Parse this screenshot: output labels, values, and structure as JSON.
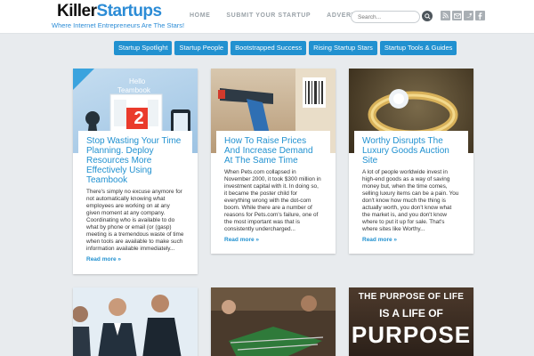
{
  "header": {
    "logo_killer": "Killer",
    "logo_startups": "Startups",
    "tagline": "Where Internet Entrepreneurs Are The Stars!",
    "nav": [
      "HOME",
      "SUBMIT YOUR STARTUP",
      "ADVERTISE"
    ],
    "search_placeholder": "Search...",
    "social": [
      "rss-icon",
      "email-icon",
      "twitter-icon",
      "facebook-icon"
    ]
  },
  "categories": [
    "Startup Spotlight",
    "Startup People",
    "Bootstrapped Success",
    "Rising Startup Stars",
    "Startup Tools & Guides"
  ],
  "posts": [
    {
      "title": "Stop Wasting Your Time Planning. Deploy Resources More Effectively Using Teambook",
      "excerpt": "There's simply no excuse anymore for not automatically knowing what employees are working on at any given moment at any company. Coordinating who is available to do what by phone or email (or (gasp) meeting is a tremendous waste of time when tools are available to make such information available immediately...",
      "read_more": "Read more »",
      "thumb_text_1": "Hello",
      "thumb_text_2": "Teambook",
      "thumb_number": "2"
    },
    {
      "title": "How To Raise Prices And Increase Demand At The Same Time",
      "excerpt": "When Pets.com collapsed in November 2000, it took $300 million in investment capital with it. In doing so, it became the poster child for everything wrong with the dot-com boom. While there are a number of reasons for Pets.com's failure, one of the most important was that is consistently undercharged...",
      "read_more": "Read more »"
    },
    {
      "title": "Worthy Disrupts The Luxury Goods Auction Site",
      "excerpt": "A lot of people worldwide invest in high-end goods as a way of saving money but, when the time comes, selling luxury items can be a pain. You don't know how much the thing is actually worth, you don't know what the market is, and you don't know where to put it up for sale. That's where sites like Worthy...",
      "read_more": "Read more »"
    }
  ],
  "bottom_thumb_text": {
    "line1": "THE PURPOSE OF LIFE",
    "line2": "IS A LIFE OF",
    "line3": "PURPOSE"
  },
  "colors": {
    "accent": "#2191d0",
    "background": "#e8ebee"
  }
}
